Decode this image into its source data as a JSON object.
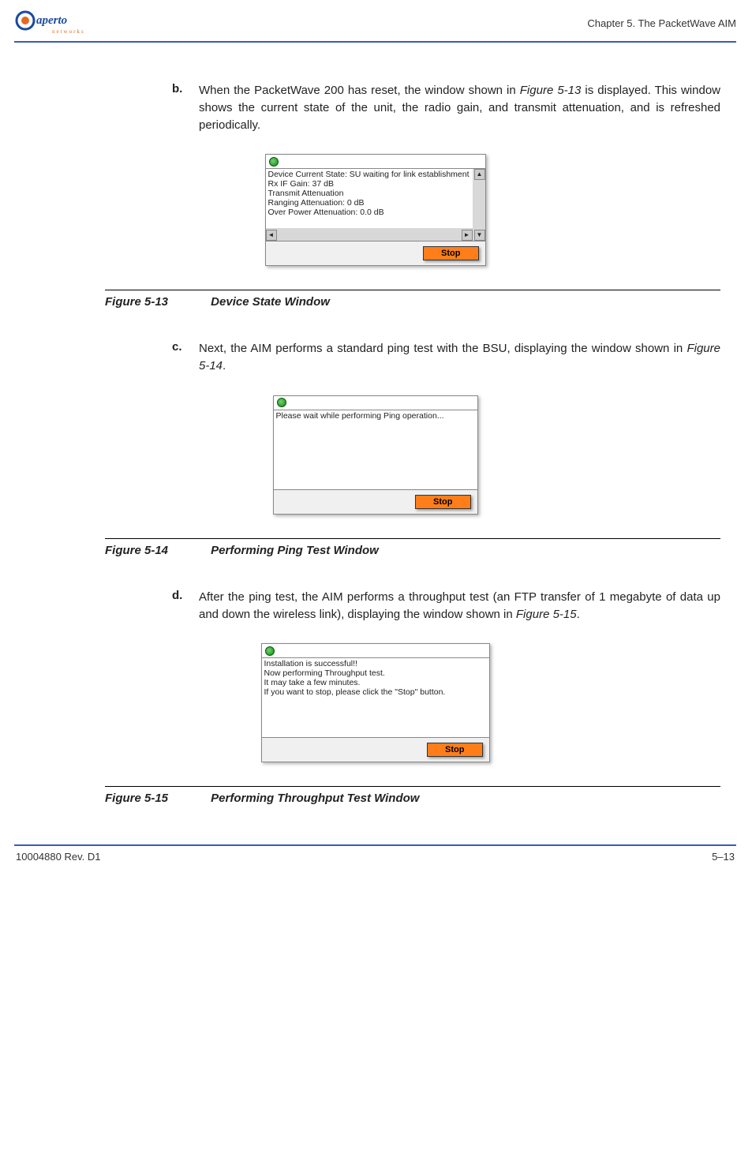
{
  "header": {
    "logo_brand": "aperto",
    "logo_sub": "networks",
    "chapter": "Chapter 5.  The PacketWave AIM"
  },
  "steps": {
    "b": {
      "letter": "b.",
      "text_before_ref": "When the PacketWave 200 has reset, the window shown in ",
      "ref": "Figure 5-13",
      "text_after_ref": " is displayed. This window shows the current state of the unit, the radio gain, and transmit attenuation, and is refreshed periodically."
    },
    "c": {
      "letter": "c.",
      "text_before_ref": "Next, the AIM performs a standard ping test with the BSU, displaying the window shown in ",
      "ref": "Figure 5-14",
      "text_after_ref": "."
    },
    "d": {
      "letter": "d.",
      "text_before_ref": "After the ping test, the AIM performs a throughput test (an FTP transfer of 1 megabyte of data up and down the wireless link), displaying the window shown in ",
      "ref": "Figure 5-15",
      "text_after_ref": "."
    }
  },
  "figures": {
    "f13": {
      "num": "Figure 5-13",
      "title": "Device State Window",
      "lines": [
        "Device Current State: SU waiting for link establishment",
        "Rx IF Gain:            37 dB",
        "Transmit Attenuation",
        "  Ranging Attenuation:  0 dB",
        "  Over Power Attenuation: 0.0 dB"
      ],
      "stop": "Stop"
    },
    "f14": {
      "num": "Figure 5-14",
      "title": "Performing Ping Test Window",
      "lines": [
        "Please wait while performing Ping operation..."
      ],
      "stop": "Stop"
    },
    "f15": {
      "num": "Figure 5-15",
      "title": "Performing Throughput Test Window",
      "lines": [
        "Installation is successful!!",
        " Now performing Throughput test.",
        " It may take a few minutes.",
        " If you want to stop, please click the \"Stop\" button."
      ],
      "stop": "Stop"
    }
  },
  "footer": {
    "left": "10004880 Rev. D1",
    "right": "5–13"
  }
}
